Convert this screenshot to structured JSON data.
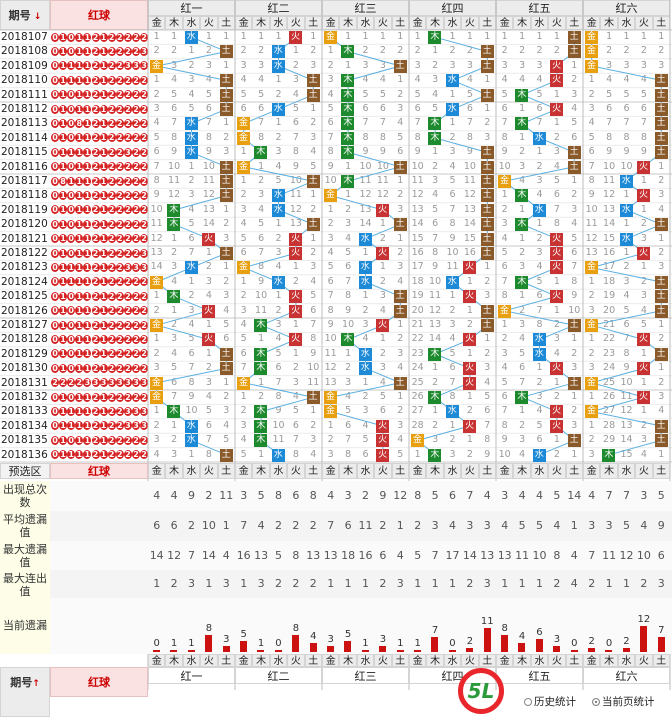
{
  "header": {
    "period_label": "期号",
    "sort_arrow": "↓",
    "red_label": "红球",
    "zones": [
      "红一",
      "红二",
      "红三",
      "红四",
      "红五",
      "红六"
    ],
    "elements": [
      "金",
      "木",
      "水",
      "火",
      "土"
    ]
  },
  "colors": {
    "金": "#e8a010",
    "木": "#1e8a2e",
    "水": "#1d8ad8",
    "火": "#c83232",
    "土": "#8a5a2b",
    "ball": "#d52222",
    "line": "#5bb0e0"
  },
  "issues": [
    "2018107",
    "2018108",
    "2018109",
    "2018110",
    "2018111",
    "2018112",
    "2018113",
    "2018114",
    "2018115",
    "2018116",
    "2018117",
    "2018118",
    "2018119",
    "2018120",
    "2018121",
    "2018122",
    "2018123",
    "2018124",
    "2018125",
    "2018126",
    "2018127",
    "2018128",
    "2018129",
    "2018130",
    "2018131",
    "2018132",
    "2018133",
    "2018134",
    "2018135",
    "2018136"
  ],
  "draws": [
    "010112122222",
    "010112122223",
    "011112122333",
    "011112122222",
    "010112122222",
    "010112122222",
    "010812122222",
    "010112122222",
    "011112122322",
    "010112122222",
    "081112122222",
    "010112122222",
    "010112122222",
    "010112122222",
    "010112122222",
    "010112122223",
    "011112122333",
    "011112122222",
    "010112122222",
    "010112122222",
    "010112122222",
    "010112122222",
    "010112122222",
    "010112122222",
    "222233333333",
    "010112122222",
    "011112122333",
    "011112122333",
    "010112122222",
    "011112122222"
  ],
  "chart_data": {
    "type": "table",
    "title": "",
    "zones": [
      "红一",
      "红二",
      "红三",
      "红四",
      "红五",
      "红六"
    ],
    "elements": [
      "金",
      "木",
      "水",
      "火",
      "土"
    ],
    "issues": [
      "2018107",
      "2018108",
      "2018109",
      "2018110",
      "2018111",
      "2018112",
      "2018113",
      "2018114",
      "2018115",
      "2018116",
      "2018117",
      "2018118",
      "2018119",
      "2018120",
      "2018121",
      "2018122",
      "2018123",
      "2018124",
      "2018125",
      "2018126",
      "2018127",
      "2018128",
      "2018129",
      "2018130",
      "2018131",
      "2018132",
      "2018133",
      "2018134",
      "2018135",
      "2018136"
    ],
    "hits": [
      [
        2,
        3,
        0,
        1,
        4,
        0
      ],
      [
        4,
        2,
        1,
        4,
        4,
        0
      ],
      [
        0,
        2,
        4,
        4,
        3,
        0
      ],
      [
        4,
        4,
        1,
        2,
        3,
        4
      ],
      [
        4,
        4,
        1,
        4,
        1,
        4
      ],
      [
        4,
        2,
        1,
        2,
        3,
        4
      ],
      [
        2,
        0,
        1,
        1,
        1,
        4
      ],
      [
        2,
        0,
        1,
        1,
        2,
        4
      ],
      [
        2,
        1,
        1,
        4,
        4,
        4
      ],
      [
        4,
        0,
        4,
        4,
        4,
        3
      ],
      [
        4,
        4,
        1,
        4,
        0,
        2
      ],
      [
        4,
        2,
        0,
        4,
        1,
        3
      ],
      [
        1,
        2,
        3,
        4,
        2,
        2
      ],
      [
        1,
        4,
        4,
        4,
        1,
        4
      ],
      [
        3,
        3,
        2,
        4,
        3,
        2
      ],
      [
        4,
        3,
        3,
        4,
        3,
        3
      ],
      [
        2,
        0,
        2,
        3,
        3,
        0
      ],
      [
        0,
        2,
        2,
        2,
        1,
        4
      ],
      [
        1,
        3,
        4,
        3,
        3,
        4
      ],
      [
        3,
        3,
        4,
        4,
        0,
        4
      ],
      [
        0,
        1,
        3,
        4,
        4,
        0
      ],
      [
        3,
        3,
        1,
        3,
        2,
        3
      ],
      [
        4,
        1,
        2,
        1,
        2,
        4
      ],
      [
        4,
        1,
        2,
        3,
        3,
        3
      ],
      [
        0,
        0,
        4,
        3,
        4,
        0
      ],
      [
        0,
        4,
        0,
        1,
        1,
        3
      ],
      [
        1,
        1,
        0,
        2,
        3,
        0
      ],
      [
        2,
        1,
        3,
        3,
        3,
        4
      ],
      [
        2,
        1,
        3,
        0,
        4,
        4
      ],
      [
        4,
        2,
        3,
        1,
        2,
        1
      ]
    ],
    "stats": {
      "labels": [
        "出现总次数",
        "平均遗漏值",
        "最大遗漏值",
        "最大连出值",
        "当前遗漏"
      ],
      "total_count": [
        [
          4,
          4,
          9,
          2,
          11
        ],
        [
          3,
          5,
          8,
          6,
          8
        ],
        [
          4,
          3,
          2,
          9,
          12
        ],
        [
          8,
          5,
          6,
          7,
          4
        ],
        [
          3,
          4,
          4,
          5,
          14
        ],
        [
          4,
          7,
          7,
          3,
          5
        ]
      ],
      "avg_omission": [
        [
          6,
          6,
          2,
          10,
          1
        ],
        [
          7,
          4,
          2,
          2,
          2
        ],
        [
          7,
          6,
          11,
          2,
          1
        ],
        [
          2,
          3,
          4,
          3,
          3
        ],
        [
          4,
          5,
          5,
          4,
          1
        ],
        [
          3,
          3,
          5,
          4,
          9
        ]
      ],
      "max_omission": [
        [
          14,
          12,
          7,
          14,
          4
        ],
        [
          16,
          13,
          5,
          8,
          13
        ],
        [
          13,
          18,
          16,
          6,
          4
        ],
        [
          5,
          7,
          17,
          14,
          13
        ],
        [
          13,
          11,
          10,
          8,
          4
        ],
        [
          7,
          11,
          12,
          10,
          6
        ]
      ],
      "max_streak": [
        [
          1,
          2,
          3,
          1,
          3
        ],
        [
          1,
          3,
          2,
          2,
          2
        ],
        [
          1,
          1,
          1,
          2,
          3
        ],
        [
          1,
          1,
          1,
          2,
          3
        ],
        [
          1,
          1,
          1,
          2,
          4
        ],
        [
          2,
          1,
          1,
          2,
          3
        ]
      ],
      "current_omission": [
        [
          0,
          1,
          1,
          8,
          3
        ],
        [
          5,
          1,
          0,
          8,
          4
        ],
        [
          3,
          5,
          1,
          3,
          1
        ],
        [
          1,
          7,
          0,
          2,
          11
        ],
        [
          8,
          4,
          6,
          3,
          0
        ],
        [
          2,
          0,
          2,
          12,
          7
        ]
      ]
    }
  },
  "preselect": {
    "label": "预选区",
    "red_label": "红球"
  },
  "footer": {
    "period_label": "期号",
    "sort_arrow": "↑",
    "red_label": "红球"
  },
  "options": {
    "history": "历史统计",
    "current": "当前页统计"
  },
  "logo": {
    "text": "5L"
  }
}
